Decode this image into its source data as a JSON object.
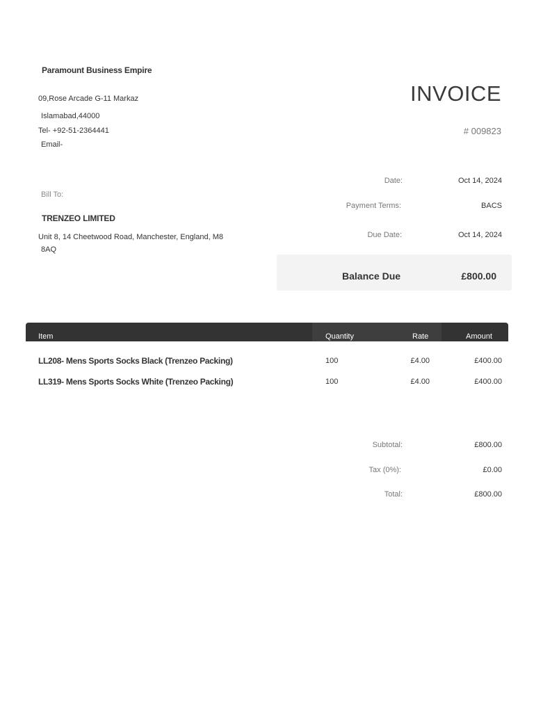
{
  "company": {
    "name": "Paramount Business Empire",
    "address_line1": "09,Rose Arcade G-11 Markaz",
    "address_line2": "Islamabad,44000",
    "phone": "Tel- +92-51-2364441",
    "email": "Email-"
  },
  "invoice": {
    "title": "INVOICE",
    "number": "# 009823"
  },
  "meta": {
    "date_label": "Date:",
    "date_value": "Oct 14, 2024",
    "terms_label": "Payment Terms:",
    "terms_value": "BACS",
    "due_label": "Due Date:",
    "due_value": "Oct 14, 2024"
  },
  "bill_to": {
    "label": "Bill To:",
    "name": "TRENZEO LIMITED",
    "address_line1": "Unit 8, 14 Cheetwood Road, Manchester, England, M8",
    "address_line2": "8AQ"
  },
  "balance": {
    "label": "Balance Due",
    "value": "£800.00"
  },
  "table": {
    "headers": [
      "Item",
      "Quantity",
      "Rate",
      "Amount"
    ],
    "rows": [
      {
        "item": "LL208- Mens Sports Socks Black (Trenzeo Packing)",
        "quantity": "100",
        "rate": "£4.00",
        "amount": "£400.00"
      },
      {
        "item": "LL319- Mens Sports Socks White (Trenzeo Packing)",
        "quantity": "100",
        "rate": "£4.00",
        "amount": "£400.00"
      }
    ]
  },
  "totals": {
    "subtotal_label": "Subtotal:",
    "subtotal_value": "£800.00",
    "tax_label": "Tax (0%):",
    "tax_value": "£0.00",
    "total_label": "Total:",
    "total_value": "£800.00"
  },
  "colors": {
    "header_bg": "#333333",
    "balance_bg": "#f3f3f3"
  }
}
